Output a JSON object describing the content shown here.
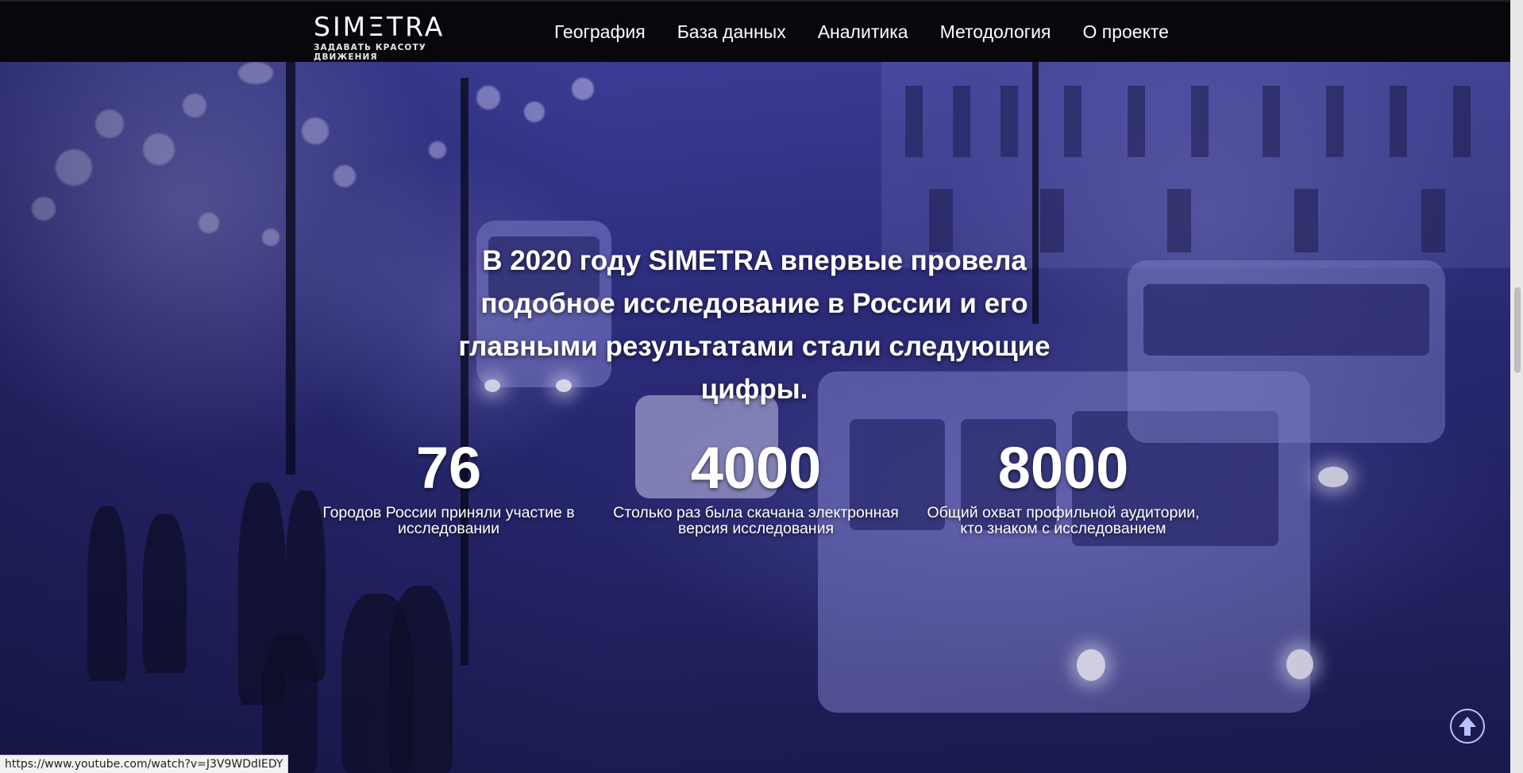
{
  "header": {
    "logo_text": "SIMΞTRA",
    "logo_tagline": "ЗАДАВАТЬ КРАСОТУ ДВИЖЕНИЯ",
    "nav": [
      "География",
      "База данных",
      "Аналитика",
      "Методология",
      "О проекте"
    ]
  },
  "hero": {
    "headline": "В 2020 году SIMETRA впервые провела подобное исследование в России и его главными результатами стали следующие цифры.",
    "stats": [
      {
        "value": "76",
        "label": "Городов России приняли участие в исследовании"
      },
      {
        "value": "4000",
        "label": "Столько раз была скачана электронная версия исследования"
      },
      {
        "value": "8000",
        "label": "Общий охват профильной аудитории, кто знаком с исследованием"
      }
    ]
  },
  "status_bar": {
    "url": "https://www.youtube.com/watch?v=J3V9WDdIEDY"
  },
  "colors": {
    "tint": "#3e3e9a",
    "header_bg": "#08080c",
    "accent_ring": "#b8c2ff"
  },
  "icons": {
    "scroll_top": "arrow-up-circle-icon"
  }
}
